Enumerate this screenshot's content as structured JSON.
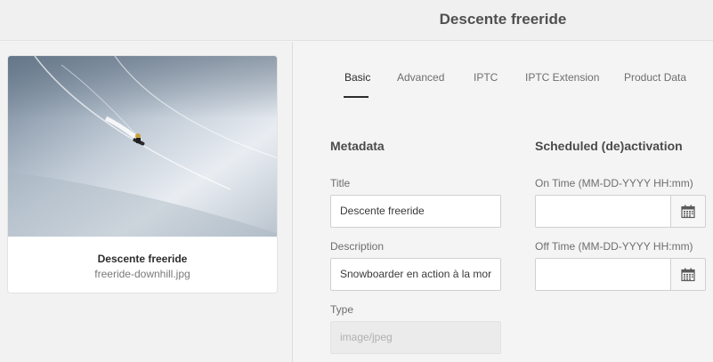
{
  "header": {
    "title": "Descente freeride"
  },
  "asset_card": {
    "title": "Descente freeride",
    "filename": "freeride-downhill.jpg",
    "thumbnail_icon": "snowboarder-photo"
  },
  "tabs": [
    {
      "label": "Basic",
      "active": true
    },
    {
      "label": "Advanced",
      "active": false
    },
    {
      "label": "IPTC",
      "active": false
    },
    {
      "label": "IPTC Extension",
      "active": false
    },
    {
      "label": "Product Data",
      "active": false
    }
  ],
  "metadata": {
    "heading": "Metadata",
    "title_label": "Title",
    "title_value": "Descente freeride",
    "description_label": "Description",
    "description_value": "Snowboarder en action à la mor",
    "type_label": "Type",
    "type_value": "image/jpeg"
  },
  "scheduling": {
    "heading": "Scheduled (de)activation",
    "on_time_label": "On Time (MM-DD-YYYY HH:mm)",
    "on_time_value": "",
    "off_time_label": "Off Time (MM-DD-YYYY HH:mm)",
    "off_time_value": "",
    "calendar_icon": "calendar-icon"
  },
  "colors": {
    "background": "#f4f4f4",
    "text": "#4b4b4b",
    "active_tab": "#2c2c2c"
  }
}
